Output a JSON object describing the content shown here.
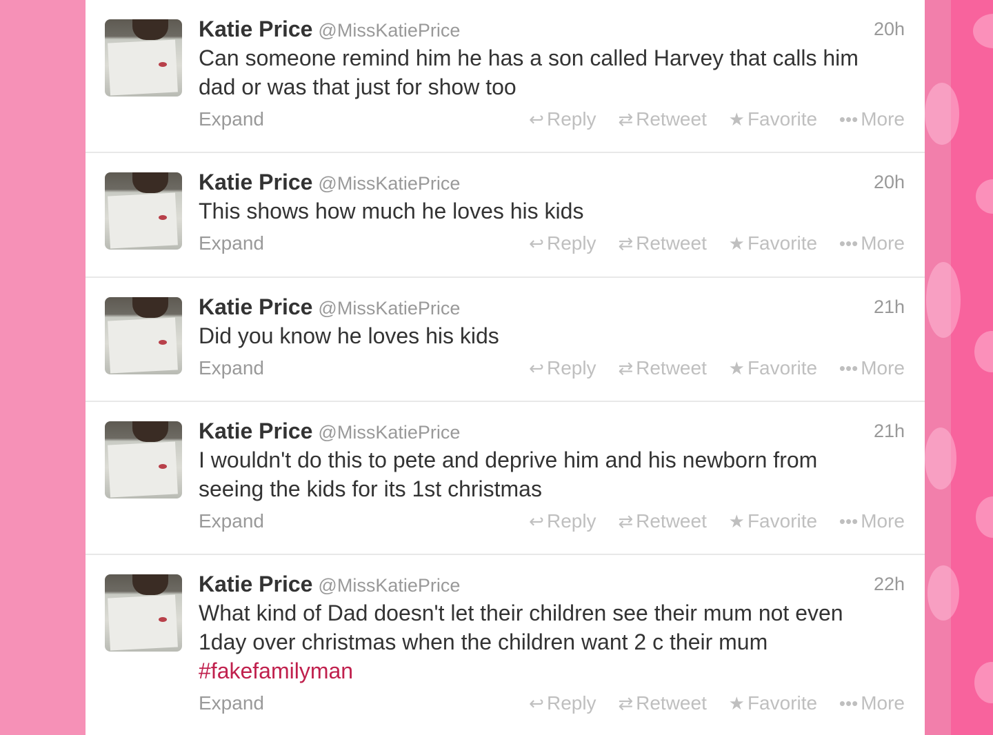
{
  "tweets": [
    {
      "name": "Katie Price",
      "handle": "@MissKatiePrice",
      "time": "20h",
      "lines": [
        "Can someone remind him he has a son called Harvey that calls him",
        "dad or was that just for show too"
      ],
      "hashtag": ""
    },
    {
      "name": "Katie Price",
      "handle": "@MissKatiePrice",
      "time": "20h",
      "lines": [
        "This shows how much he loves his kids"
      ],
      "hashtag": ""
    },
    {
      "name": "Katie Price",
      "handle": "@MissKatiePrice",
      "time": "21h",
      "lines": [
        "Did you know he loves his kids"
      ],
      "hashtag": ""
    },
    {
      "name": "Katie Price",
      "handle": "@MissKatiePrice",
      "time": "21h",
      "lines": [
        "I wouldn't do this to pete and deprive him and his newborn from",
        "seeing the kids for its 1st christmas"
      ],
      "hashtag": ""
    },
    {
      "name": "Katie Price",
      "handle": "@MissKatiePrice",
      "time": "22h",
      "lines": [
        "What kind of Dad doesn't let their children see their mum not even",
        "1day over christmas when the children want 2 c their mum"
      ],
      "hashtag": "#fakefamilyman"
    }
  ],
  "actions": {
    "expand": "Expand",
    "reply": "Reply",
    "retweet": "Retweet",
    "favorite": "Favorite",
    "more": "More"
  },
  "icons": {
    "reply": "reply-arrow-icon",
    "retweet": "retweet-icon",
    "favorite": "star-icon",
    "more": "ellipsis-icon"
  },
  "colors": {
    "background_pink": "#f691b7",
    "hashtag": "#c0204d",
    "muted_text": "#999999",
    "action_text": "#bfbfbf"
  }
}
